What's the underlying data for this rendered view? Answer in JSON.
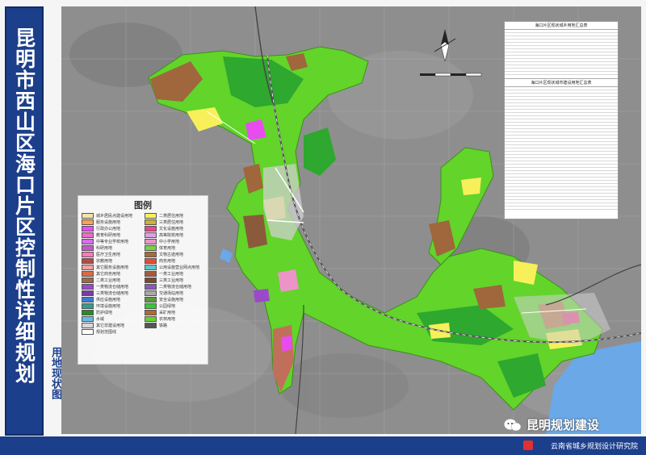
{
  "title": "昆明市西山区海口片区控制性详细规划",
  "subtitle": "用地现状图",
  "legend": {
    "title": "图例",
    "items": [
      {
        "label": "城乡居民点建设用地",
        "color": "#f2e3a8"
      },
      {
        "label": "二类居住用地",
        "color": "#f7f05a"
      },
      {
        "label": "服务设施用地",
        "color": "#f4a35a"
      },
      {
        "label": "三类居住用地",
        "color": "#c8b23c"
      },
      {
        "label": "行政办公用地",
        "color": "#e84cf0"
      },
      {
        "label": "文化设施用地",
        "color": "#e8488c"
      },
      {
        "label": "教育科研用地",
        "color": "#f06ac8"
      },
      {
        "label": "高等院校用地",
        "color": "#e59aea"
      },
      {
        "label": "中等专业学校用地",
        "color": "#d86cf0"
      },
      {
        "label": "中小学用地",
        "color": "#ec94c8"
      },
      {
        "label": "科研用地",
        "color": "#c05ac8"
      },
      {
        "label": "体育用地",
        "color": "#7ad048"
      },
      {
        "label": "医疗卫生用地",
        "color": "#ff7ab8"
      },
      {
        "label": "文物古迹用地",
        "color": "#a86a3a"
      },
      {
        "label": "宗教用地",
        "color": "#b84848"
      },
      {
        "label": "商务用地",
        "color": "#e84a3a"
      },
      {
        "label": "其它服务设施用地",
        "color": "#f2a0a0"
      },
      {
        "label": "公用设施营业网点用地",
        "color": "#5ac8c8"
      },
      {
        "label": "其它商务用地",
        "color": "#e06840"
      },
      {
        "label": "一类工业用地",
        "color": "#a85a3a"
      },
      {
        "label": "二类工业用地",
        "color": "#9a6a4a"
      },
      {
        "label": "三类工业用地",
        "color": "#7a4a2a"
      },
      {
        "label": "一类物流仓储用地",
        "color": "#9a4ac8"
      },
      {
        "label": "二类物流仓储用地",
        "color": "#8a5ab8"
      },
      {
        "label": "三类物流仓储用地",
        "color": "#7a3aa8"
      },
      {
        "label": "交通场站用地",
        "color": "#a8a8a8"
      },
      {
        "label": "供应设施用地",
        "color": "#3a7ad8"
      },
      {
        "label": "安全设施用地",
        "color": "#5a9a3a"
      },
      {
        "label": "环境设施用地",
        "color": "#3a9a8a"
      },
      {
        "label": "公园绿地",
        "color": "#38c838"
      },
      {
        "label": "防护绿地",
        "color": "#2a8a2a"
      },
      {
        "label": "采矿用地",
        "color": "#b06a3a"
      },
      {
        "label": "水域",
        "color": "#6ab8e8"
      },
      {
        "label": "农林用地",
        "color": "#62d42a"
      },
      {
        "label": "其它非建设用地",
        "color": "#d8d8d8"
      },
      {
        "label": "铁路",
        "color": "#555555"
      },
      {
        "label": "规划范围线",
        "color": "#ffffff"
      }
    ]
  },
  "table": {
    "title_1": "海口片区现状城乡用地汇总表",
    "title_2": "海口片区现状城市建设用地汇总表"
  },
  "watermark": "昆明规划建设",
  "organization": "云南省城乡规划设计研究院",
  "colors": {
    "frame_blue": "#1c3f8c",
    "green_land": "#62d42a",
    "dark_green": "#2ea82e",
    "brown_industrial": "#a0663c",
    "water": "#6aa8e8",
    "terrain": "#8e8e8e"
  }
}
